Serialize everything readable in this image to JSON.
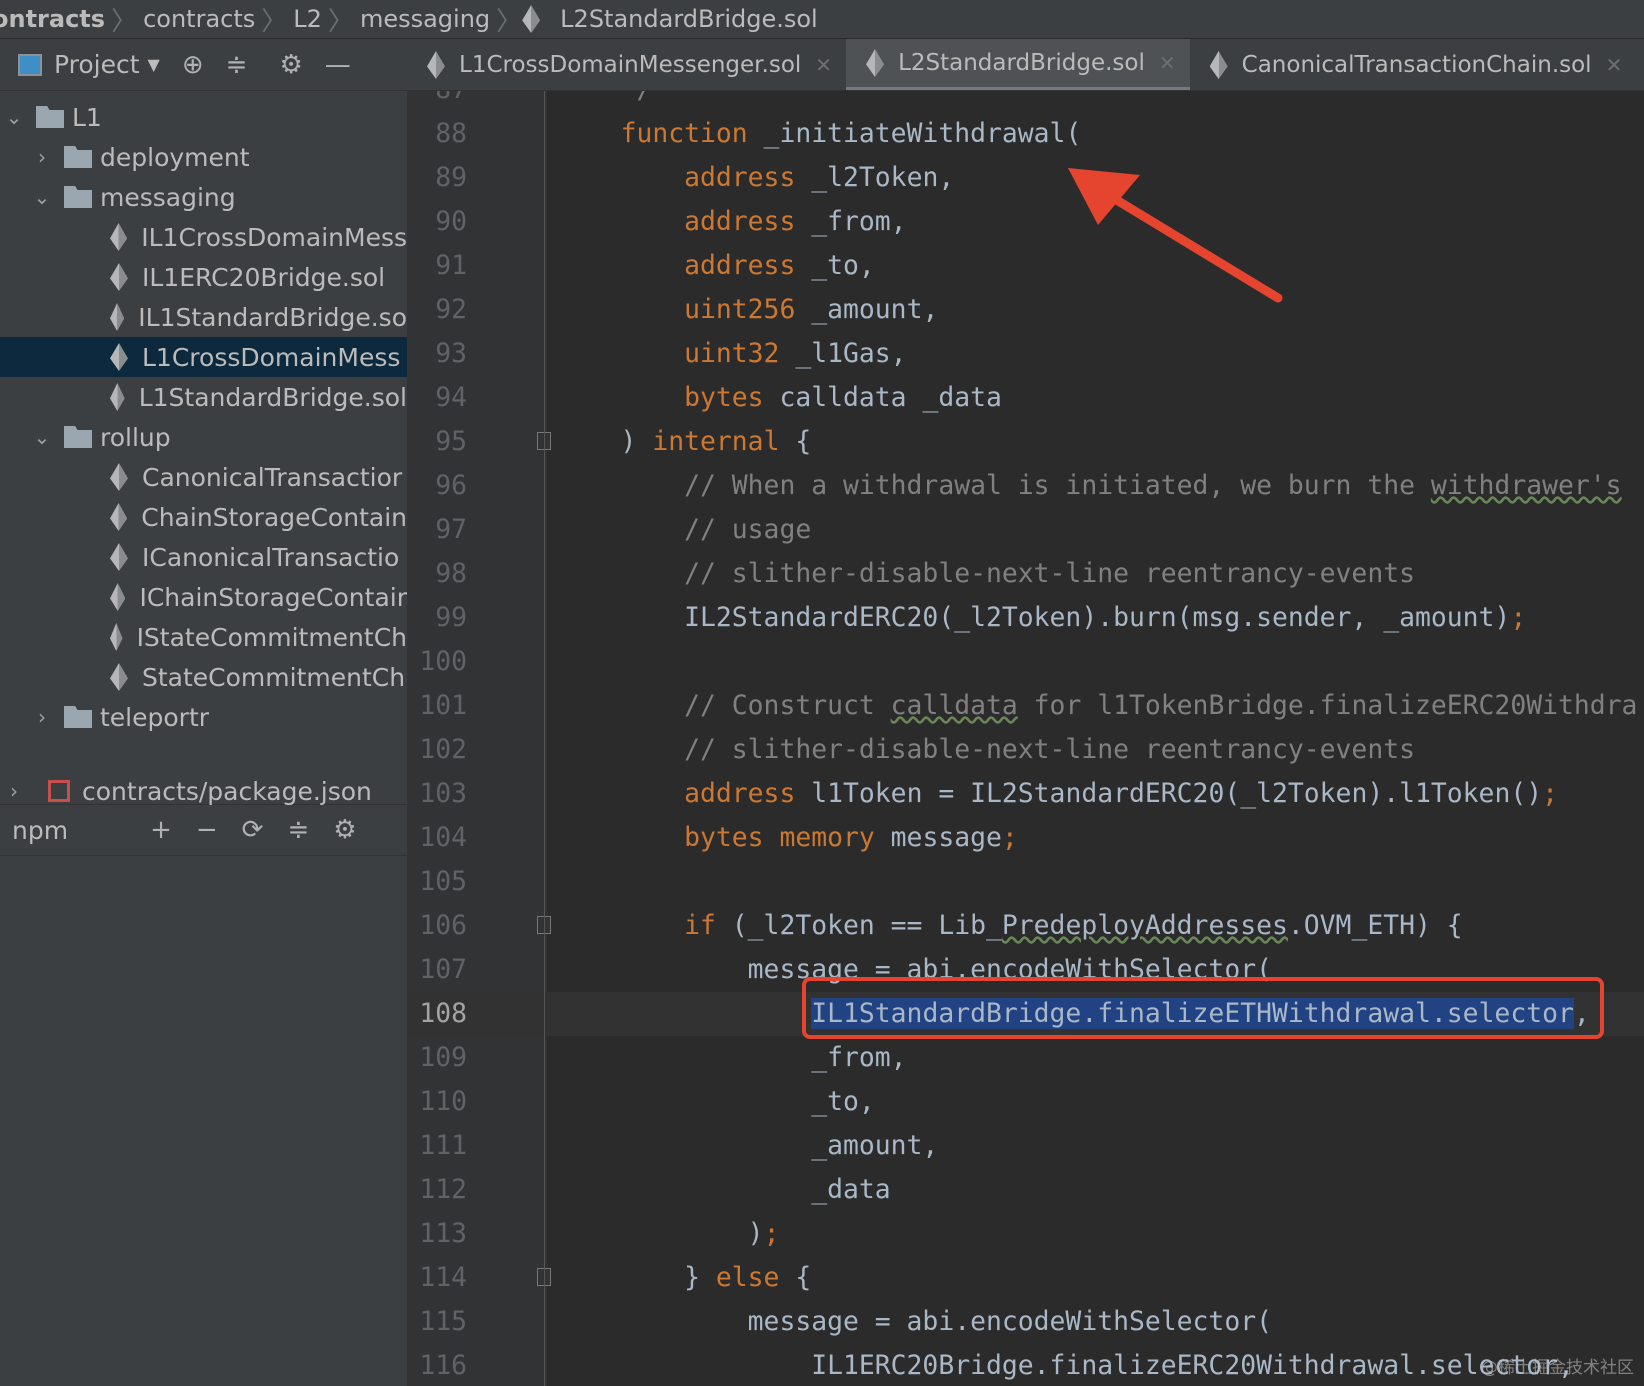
{
  "breadcrumb": [
    "ontracts",
    "contracts",
    "L2",
    "messaging",
    "L2StandardBridge.sol"
  ],
  "toolbar": {
    "project_label": "Project"
  },
  "tabs": [
    {
      "label": "L1CrossDomainMessenger.sol",
      "active": false
    },
    {
      "label": "L2StandardBridge.sol",
      "active": true
    },
    {
      "label": "CanonicalTransactionChain.sol",
      "active": false
    }
  ],
  "tree": [
    {
      "label": "L1",
      "type": "folder",
      "level": 0,
      "open": true
    },
    {
      "label": "deployment",
      "type": "folder",
      "level": 1,
      "open": false
    },
    {
      "label": "messaging",
      "type": "folder",
      "level": 1,
      "open": true
    },
    {
      "label": "IL1CrossDomainMess",
      "type": "file",
      "level": 2
    },
    {
      "label": "IL1ERC20Bridge.sol",
      "type": "file",
      "level": 2
    },
    {
      "label": "IL1StandardBridge.so",
      "type": "file",
      "level": 2
    },
    {
      "label": "L1CrossDomainMess",
      "type": "file",
      "level": 2,
      "selected": true
    },
    {
      "label": "L1StandardBridge.sol",
      "type": "file",
      "level": 2
    },
    {
      "label": "rollup",
      "type": "folder",
      "level": 1,
      "open": true
    },
    {
      "label": "CanonicalTransactior",
      "type": "file",
      "level": 2
    },
    {
      "label": "ChainStorageContain",
      "type": "file",
      "level": 2
    },
    {
      "label": "ICanonicalTransactio",
      "type": "file",
      "level": 2
    },
    {
      "label": "IChainStorageContair",
      "type": "file",
      "level": 2
    },
    {
      "label": "IStateCommitmentCh",
      "type": "file",
      "level": 2
    },
    {
      "label": "StateCommitmentCh",
      "type": "file",
      "level": 2
    },
    {
      "label": "teleportr",
      "type": "folder",
      "level": 1,
      "open": false
    }
  ],
  "npm": {
    "label": "npm",
    "package": "contracts/package.json"
  },
  "editor": {
    "current_line": 108,
    "lines": [
      {
        "n": "87",
        "t": [
          [
            "    */",
            "cm"
          ]
        ]
      },
      {
        "n": "88",
        "t": [
          [
            "    ",
            ""
          ],
          [
            "function",
            "kw"
          ],
          [
            " _initiateWithdrawal(",
            ""
          ]
        ]
      },
      {
        "n": "89",
        "t": [
          [
            "        ",
            ""
          ],
          [
            "address",
            "kw"
          ],
          [
            " _l2Token,",
            ""
          ]
        ]
      },
      {
        "n": "90",
        "t": [
          [
            "        ",
            ""
          ],
          [
            "address",
            "kw"
          ],
          [
            " _from,",
            ""
          ]
        ]
      },
      {
        "n": "91",
        "t": [
          [
            "        ",
            ""
          ],
          [
            "address",
            "kw"
          ],
          [
            " _to,",
            ""
          ]
        ]
      },
      {
        "n": "92",
        "t": [
          [
            "        ",
            ""
          ],
          [
            "uint256",
            "kw"
          ],
          [
            " _amount,",
            ""
          ]
        ]
      },
      {
        "n": "93",
        "t": [
          [
            "        ",
            ""
          ],
          [
            "uint32",
            "kw"
          ],
          [
            " _l1Gas,",
            ""
          ]
        ]
      },
      {
        "n": "94",
        "t": [
          [
            "        ",
            ""
          ],
          [
            "bytes",
            "kw"
          ],
          [
            " calldata _data",
            ""
          ]
        ]
      },
      {
        "n": "95",
        "t": [
          [
            "    ) ",
            ""
          ],
          [
            "internal",
            "kw"
          ],
          [
            " {",
            ""
          ]
        ],
        "fold": true
      },
      {
        "n": "96",
        "t": [
          [
            "        // When a withdrawal is initiated, we burn the ",
            "cm"
          ],
          [
            "withdrawer's",
            "cm ul"
          ]
        ]
      },
      {
        "n": "97",
        "t": [
          [
            "        // usage",
            "cm"
          ]
        ]
      },
      {
        "n": "98",
        "t": [
          [
            "        // slither-disable-next-line reentrancy-events",
            "cm"
          ]
        ]
      },
      {
        "n": "99",
        "t": [
          [
            "        IL2StandardERC20(_l2Token).burn(msg.sender, _amount)",
            ""
          ],
          [
            ";",
            "kw"
          ]
        ]
      },
      {
        "n": "100",
        "t": []
      },
      {
        "n": "101",
        "t": [
          [
            "        // Construct ",
            "cm"
          ],
          [
            "calldata",
            "cm ul"
          ],
          [
            " for l1TokenBridge.finalizeERC20Withdra",
            "cm"
          ]
        ]
      },
      {
        "n": "102",
        "t": [
          [
            "        // slither-disable-next-line reentrancy-events",
            "cm"
          ]
        ]
      },
      {
        "n": "103",
        "t": [
          [
            "        ",
            ""
          ],
          [
            "address",
            "kw"
          ],
          [
            " l1Token = IL2StandardERC20(_l2Token).l1Token()",
            ""
          ],
          [
            ";",
            "kw"
          ]
        ]
      },
      {
        "n": "104",
        "t": [
          [
            "        ",
            ""
          ],
          [
            "bytes memory",
            "kw"
          ],
          [
            " message",
            ""
          ],
          [
            ";",
            "kw"
          ]
        ]
      },
      {
        "n": "105",
        "t": []
      },
      {
        "n": "106",
        "t": [
          [
            "        ",
            ""
          ],
          [
            "if",
            "kw"
          ],
          [
            " (_l2Token == Lib_",
            ""
          ],
          [
            "PredeployAddresses",
            "ul"
          ],
          [
            ".OVM_ETH) {",
            ""
          ]
        ],
        "fold": true
      },
      {
        "n": "107",
        "t": [
          [
            "            message = abi.encodeWithSelector(",
            ""
          ]
        ]
      },
      {
        "n": "108",
        "t": [
          [
            "                ",
            ""
          ],
          [
            "IL1StandardBridge.finalizeETHWithdrawal.selector",
            "sl"
          ],
          [
            ",",
            ""
          ]
        ]
      },
      {
        "n": "109",
        "t": [
          [
            "                _from,",
            ""
          ]
        ]
      },
      {
        "n": "110",
        "t": [
          [
            "                _to,",
            ""
          ]
        ]
      },
      {
        "n": "111",
        "t": [
          [
            "                _amount,",
            ""
          ]
        ]
      },
      {
        "n": "112",
        "t": [
          [
            "                _data",
            ""
          ]
        ]
      },
      {
        "n": "113",
        "t": [
          [
            "            )",
            ""
          ],
          [
            ";",
            "kw"
          ]
        ]
      },
      {
        "n": "114",
        "t": [
          [
            "        } ",
            ""
          ],
          [
            "else",
            "kw"
          ],
          [
            " {",
            ""
          ]
        ],
        "fold": true
      },
      {
        "n": "115",
        "t": [
          [
            "            message = abi.encodeWithSelector(",
            ""
          ]
        ]
      },
      {
        "n": "116",
        "t": [
          [
            "                IL1ERC20Bridge.finalizeERC20Withdrawal.selector,",
            ""
          ]
        ]
      }
    ]
  },
  "watermark": "@稀土掘金技术社区",
  "colors": {
    "keyword": "#cc7832",
    "comment": "#808080",
    "text": "#a9b7c6",
    "selection": "#214283",
    "annotation": "#e5452f"
  }
}
